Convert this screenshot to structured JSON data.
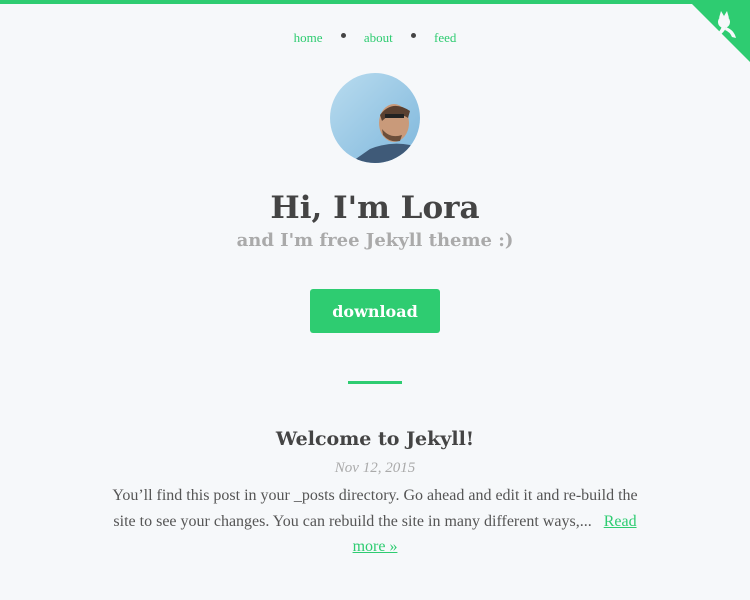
{
  "nav": {
    "items": [
      {
        "label": "home"
      },
      {
        "label": "about"
      },
      {
        "label": "feed"
      }
    ]
  },
  "corner_icon": "github-icon",
  "hero": {
    "title": "Hi, I'm Lora",
    "subtitle": "and I'm free Jekyll theme :)",
    "button_label": "download"
  },
  "post": {
    "title": "Welcome to Jekyll!",
    "date": "Nov 12, 2015",
    "excerpt": "You’ll find this post in your _posts directory. Go ahead and edit it and re-build the site to see your changes. You can rebuild the site in many different ways,...",
    "read_more": "Read more »"
  },
  "colors": {
    "accent": "#2ecc71",
    "background": "#f6f8fa",
    "text": "#444444",
    "muted": "#aaaaaa"
  }
}
